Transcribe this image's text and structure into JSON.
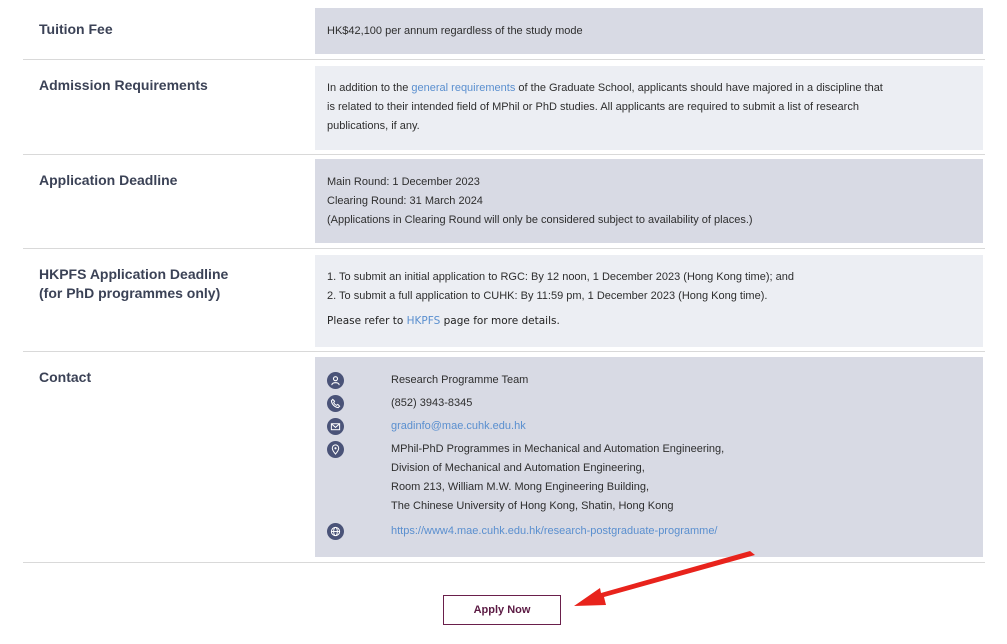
{
  "tuition": {
    "label": "Tuition Fee",
    "text": "HK$42,100 per annum regardless of the study mode"
  },
  "admission": {
    "label": "Admission Requirements",
    "pre": "In addition to the ",
    "link": "general requirements",
    "post1": " of the Graduate School, applicants should have majored in a discipline that",
    "line2": "is related to their intended field of MPhil or PhD studies. All applicants are required to submit a list of research",
    "line3": "publications, if any."
  },
  "deadline": {
    "label": "Application Deadline",
    "lines": [
      "Main Round: 1 December 2023",
      "Clearing Round: 31 March 2024",
      "(Applications in Clearing Round will only be considered subject to availability of places.)"
    ]
  },
  "hkpfs": {
    "label_line1": "HKPFS Application Deadline",
    "label_line2": "(for PhD programmes only)",
    "items": [
      "1. To submit an initial application to RGC: By 12 noon, 1 December 2023 (Hong Kong time); and",
      "2. To submit a full application to CUHK: By 11:59 pm, 1 December 2023 (Hong Kong time)."
    ],
    "note_pre": "Please refer to ",
    "note_link": "HKPFS",
    "note_post": " page for more details."
  },
  "contact": {
    "label": "Contact",
    "team": "Research Programme Team",
    "phone": "(852) 3943-8345",
    "email": "gradinfo@mae.cuhk.edu.hk",
    "address": [
      "MPhil-PhD Programmes in Mechanical and Automation Engineering,",
      "Division of Mechanical and Automation Engineering,",
      "Room 213, William M.W. Mong Engineering Building,",
      "The Chinese University of Hong Kong, Shatin, Hong Kong"
    ],
    "website": "https://www4.mae.cuhk.edu.hk/research-postgraduate-programme/",
    "icons": [
      "person-icon",
      "phone-icon",
      "mail-icon",
      "location-icon",
      "globe-icon"
    ]
  },
  "apply_label": "Apply Now",
  "colors": {
    "label": "#3b4256",
    "cell_bg": "#d8dae4",
    "link": "#5a8fcf",
    "button_border": "#6a1f4b",
    "arrow": "#e8231c"
  }
}
